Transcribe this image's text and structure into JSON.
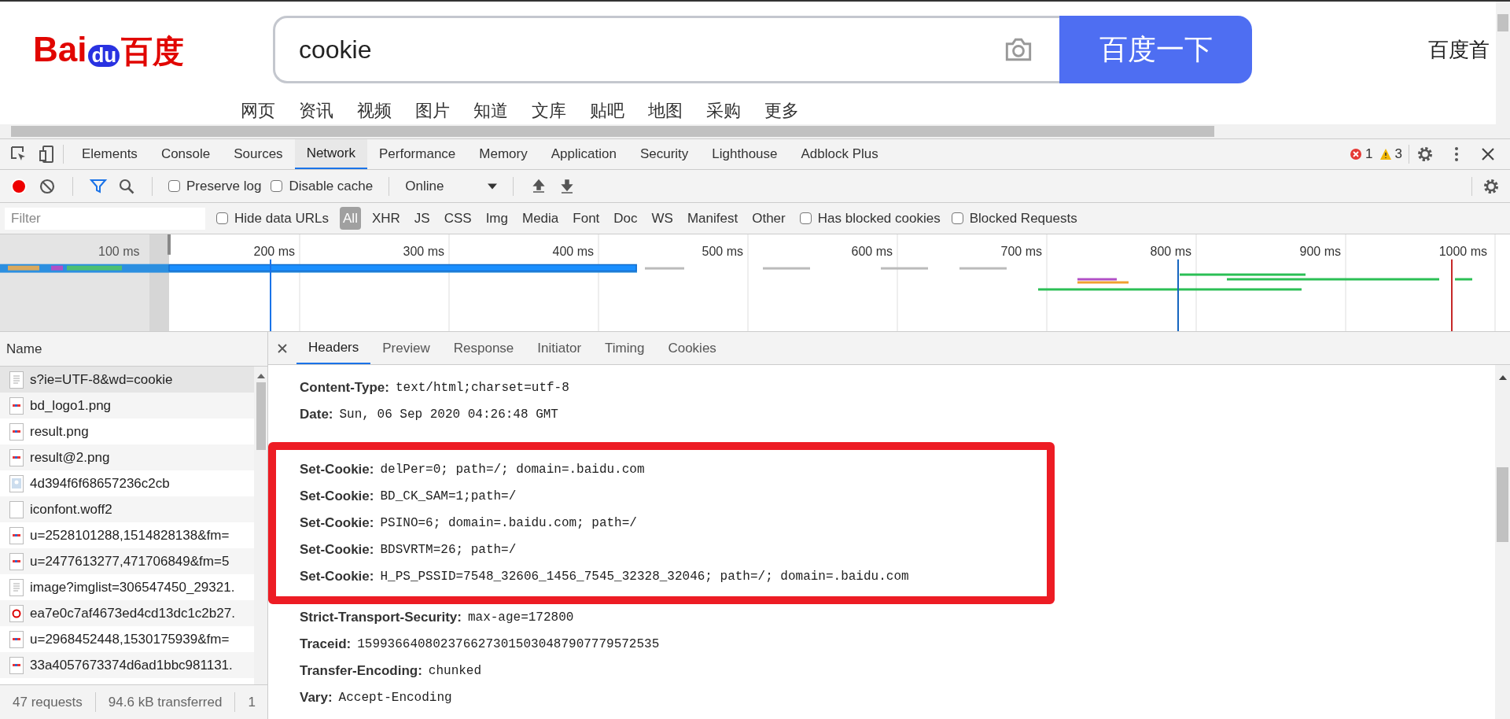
{
  "page": {
    "logo": {
      "left": "Bai",
      "paw": "du",
      "right": "百度"
    },
    "search": {
      "value": "cookie"
    },
    "search_button": "百度一下",
    "top_link": "百度首",
    "nav": [
      "网页",
      "资讯",
      "视频",
      "图片",
      "知道",
      "文库",
      "贴吧",
      "地图",
      "采购",
      "更多"
    ]
  },
  "devtools": {
    "tabs": [
      {
        "label": "Elements",
        "selected": false
      },
      {
        "label": "Console",
        "selected": false
      },
      {
        "label": "Sources",
        "selected": false
      },
      {
        "label": "Network",
        "selected": true
      },
      {
        "label": "Performance",
        "selected": false
      },
      {
        "label": "Memory",
        "selected": false
      },
      {
        "label": "Application",
        "selected": false
      },
      {
        "label": "Security",
        "selected": false
      },
      {
        "label": "Lighthouse",
        "selected": false
      },
      {
        "label": "Adblock Plus",
        "selected": false
      }
    ],
    "errors": "1",
    "warnings": "3",
    "toolbar": {
      "recording": true,
      "filter_active": true,
      "preserve_log": {
        "label": "Preserve log",
        "checked": false
      },
      "disable_cache": {
        "label": "Disable cache",
        "checked": false
      },
      "throttling": "Online"
    },
    "filter": {
      "placeholder": "Filter",
      "hide_data_urls": {
        "label": "Hide data URLs",
        "checked": false
      },
      "types": [
        {
          "label": "All",
          "selected": true
        },
        {
          "label": "XHR",
          "selected": false
        },
        {
          "label": "JS",
          "selected": false
        },
        {
          "label": "CSS",
          "selected": false
        },
        {
          "label": "Img",
          "selected": false
        },
        {
          "label": "Media",
          "selected": false
        },
        {
          "label": "Font",
          "selected": false
        },
        {
          "label": "Doc",
          "selected": false
        },
        {
          "label": "WS",
          "selected": false
        },
        {
          "label": "Manifest",
          "selected": false
        },
        {
          "label": "Other",
          "selected": false
        }
      ],
      "has_blocked_cookies": {
        "label": "Has blocked cookies",
        "checked": false
      },
      "blocked_requests": {
        "label": "Blocked Requests",
        "checked": false
      }
    },
    "timeline": {
      "overview_label": "100 ms",
      "ticks": [
        "200 ms",
        "300 ms",
        "400 ms",
        "500 ms",
        "600 ms",
        "700 ms",
        "800 ms",
        "900 ms",
        "1000 ms"
      ]
    },
    "requests_header": "Name",
    "requests": [
      {
        "name": "s?ie=UTF-8&wd=cookie",
        "kind": "document",
        "selected": true
      },
      {
        "name": "bd_logo1.png",
        "kind": "image",
        "selected": false
      },
      {
        "name": "result.png",
        "kind": "image",
        "selected": false
      },
      {
        "name": "result@2.png",
        "kind": "image",
        "selected": false
      },
      {
        "name": "4d394f6f68657236c2cb",
        "kind": "avatar",
        "selected": false
      },
      {
        "name": "iconfont.woff2",
        "kind": "font",
        "selected": false
      },
      {
        "name": "u=2528101288,1514828138&fm=",
        "kind": "image",
        "selected": false
      },
      {
        "name": "u=2477613277,471706849&fm=5",
        "kind": "image",
        "selected": false
      },
      {
        "name": "image?imglist=306547450_29321.",
        "kind": "document",
        "selected": false
      },
      {
        "name": "ea7e0c7af4673ed4cd13dc1c2b27.",
        "kind": "logo",
        "selected": false
      },
      {
        "name": "u=2968452448,1530175939&fm=",
        "kind": "image",
        "selected": false
      },
      {
        "name": "33a4057673374d6ad1bbc981131.",
        "kind": "image",
        "selected": false
      }
    ],
    "status": [
      "47 requests",
      "94.6 kB transferred",
      "1"
    ],
    "detail_tabs": [
      {
        "label": "Headers",
        "selected": true
      },
      {
        "label": "Preview",
        "selected": false
      },
      {
        "label": "Response",
        "selected": false
      },
      {
        "label": "Initiator",
        "selected": false
      },
      {
        "label": "Timing",
        "selected": false
      },
      {
        "label": "Cookies",
        "selected": false
      }
    ],
    "headers_before": [
      {
        "name": "Content-Type:",
        "value": "text/html;charset=utf-8"
      },
      {
        "name": "Date:",
        "value": "Sun, 06 Sep 2020 04:26:48 GMT"
      }
    ],
    "highlighted_headers": [
      {
        "name": "Set-Cookie:",
        "value": "delPer=0; path=/; domain=.baidu.com"
      },
      {
        "name": "Set-Cookie:",
        "value": "BD_CK_SAM=1;path=/"
      },
      {
        "name": "Set-Cookie:",
        "value": "PSINO=6; domain=.baidu.com; path=/"
      },
      {
        "name": "Set-Cookie:",
        "value": "BDSVRTM=26; path=/"
      },
      {
        "name": "Set-Cookie:",
        "value": "H_PS_PSSID=7548_32606_1456_7545_32328_32046; path=/; domain=.baidu.com"
      }
    ],
    "headers_after": [
      {
        "name": "Strict-Transport-Security:",
        "value": "max-age=172800"
      },
      {
        "name": "Traceid:",
        "value": "1599366408023766273015030487907779572535"
      },
      {
        "name": "Transfer-Encoding:",
        "value": "chunked"
      },
      {
        "name": "Vary:",
        "value": "Accept-Encoding"
      }
    ]
  }
}
